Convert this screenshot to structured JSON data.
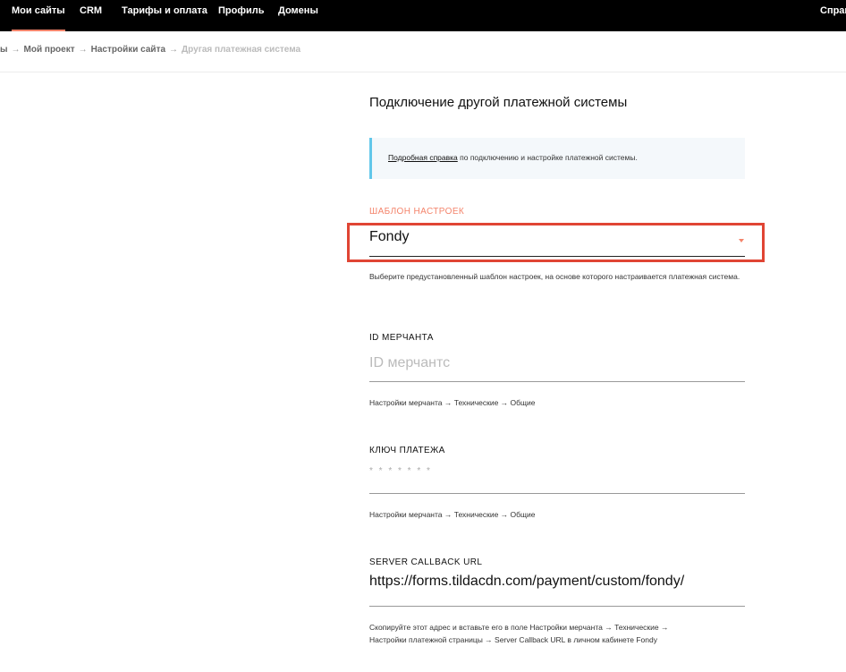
{
  "topnav": {
    "items": [
      "Мои сайты",
      "CRM",
      "Тарифы и оплата",
      "Профиль",
      "Домены"
    ],
    "right_item": "Справ"
  },
  "breadcrumb": {
    "items": [
      "ы",
      "Мой проект",
      "Настройки сайта"
    ],
    "current": "Другая платежная система"
  },
  "page": {
    "title": "Подключение другой платежной системы"
  },
  "info": {
    "link_text": "Подробная справка",
    "text": " по подключению и настройке платежной системы."
  },
  "template_field": {
    "label": "ШАБЛОН НАСТРОЕК",
    "value": "Fondy",
    "hint": "Выберите предустановленный шаблон настроек, на основе которого настраивается платежная система.",
    "accent_color": "#f4846b"
  },
  "merchant_field": {
    "label": "ID МЕРЧАНТА",
    "placeholder": "ID мерчантс",
    "hint": "Настройки мерчанта → Технические → Общие"
  },
  "payment_key_field": {
    "label": "КЛЮЧ ПЛАТЕЖА",
    "value": "* * * * * * *",
    "hint": "Настройки мерчанта → Технические → Общие"
  },
  "callback_field": {
    "label": "SERVER CALLBACK URL",
    "value": "https://forms.tildacdn.com/payment/custom/fondy/",
    "hint_line1": "Скопируйте этот адрес и вставьте его в поле Настройки мерчанта → Технические →",
    "hint_line2": "Настройки платежной страницы → Server Callback URL в личном кабинете Fondy"
  }
}
